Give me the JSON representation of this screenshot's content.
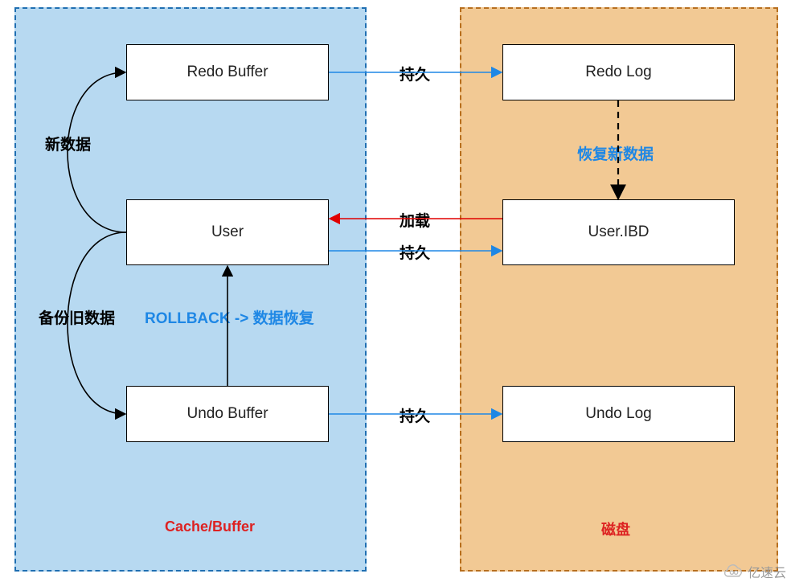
{
  "regions": {
    "cache": {
      "label": "Cache/Buffer"
    },
    "disk": {
      "label": "磁盘"
    }
  },
  "nodes": {
    "redo_buffer": {
      "label": "Redo Buffer"
    },
    "user": {
      "label": "User"
    },
    "undo_buffer": {
      "label": "Undo Buffer"
    },
    "redo_log": {
      "label": "Redo Log"
    },
    "user_ibd": {
      "label": "User.IBD"
    },
    "undo_log": {
      "label": "Undo Log"
    }
  },
  "edges": {
    "new_data": {
      "label": "新数据",
      "color": "#000"
    },
    "backup_old": {
      "label": "备份旧数据",
      "color": "#000"
    },
    "rollback": {
      "label": "ROLLBACK -> 数据恢复",
      "color": "#1e87e5"
    },
    "persist1": {
      "label": "持久",
      "color": "#000"
    },
    "persist2": {
      "label": "持久",
      "color": "#000"
    },
    "persist3": {
      "label": "持久",
      "color": "#000"
    },
    "load": {
      "label": "加载",
      "color": "#000"
    },
    "recover_new": {
      "label": "恢复新数据",
      "color": "#1e87e5"
    }
  },
  "colors": {
    "arrow_blue": "#1e87e5",
    "arrow_red": "#e00000",
    "arrow_black": "#000"
  },
  "watermark": {
    "text": "亿速云"
  }
}
